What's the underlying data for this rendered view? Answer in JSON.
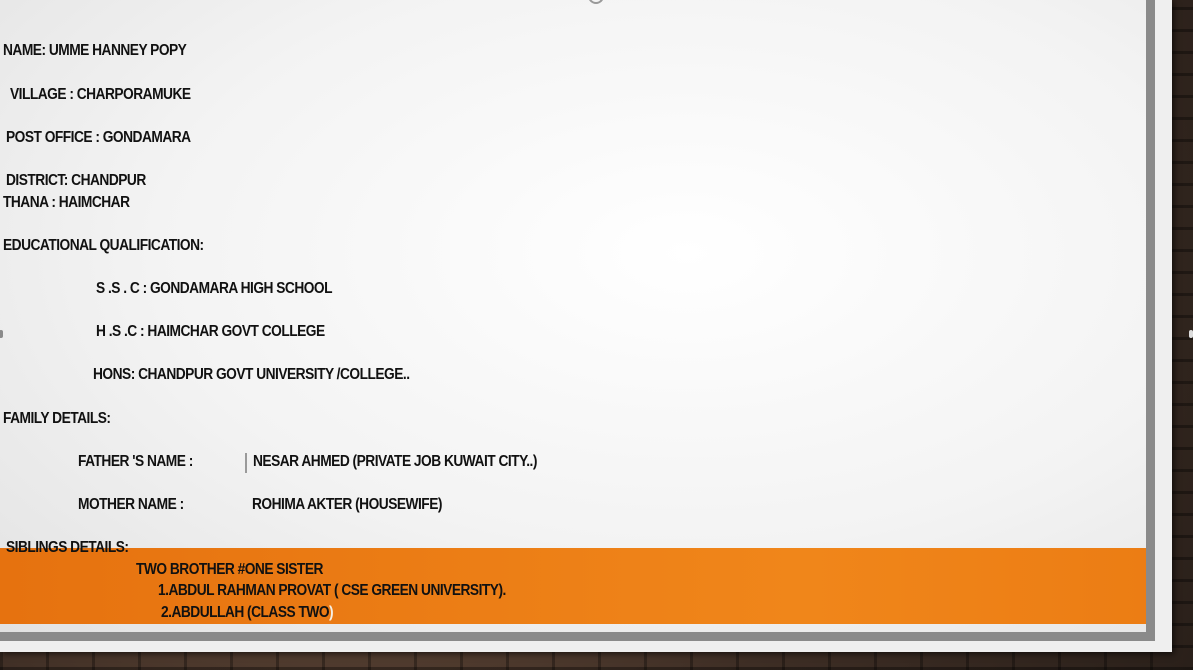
{
  "profile": {
    "name": "NAME:  UMME  HANNEY  POPY",
    "village": "VILLAGE : CHARPORAMUKE",
    "post_office": "POST OFFICE : GONDAMARA",
    "district": "DISTRICT:  CHANDPUR",
    "thana": "THANA : HAIMCHAR"
  },
  "education": {
    "heading": "EDUCATIONAL QUALIFICATION:",
    "ssc": "S .S . C : GONDAMARA HIGH SCHOOL",
    "hsc": "H .S .C : HAIMCHAR GOVT COLLEGE",
    "hons": "HONS: CHANDPUR GOVT UNIVERSITY /COLLEGE.."
  },
  "family": {
    "heading": "FAMILY DETAILS:",
    "father_label": "FATHER 'S NAME   :",
    "father_value": "NESAR AHMED   (PRIVATE JOB KUWAIT CITY..)",
    "mother_label": "MOTHER NAME     :",
    "mother_value": "ROHIMA AKTER (HOUSEWIFE)"
  },
  "siblings": {
    "heading": "SIBLINGS DETAILS:",
    "summary": "TWO BROTHER #ONE SISTER",
    "item1": "1.ABDUL RAHMAN PROVAT  ( CSE   GREEN UNIVERSITY).",
    "item2_main": "2.ABDULLAH (CLASS TWO",
    "item2_close": ")"
  },
  "colors": {
    "band": "#f0861a",
    "text": "#111111",
    "paper": "#f3f3f3"
  }
}
